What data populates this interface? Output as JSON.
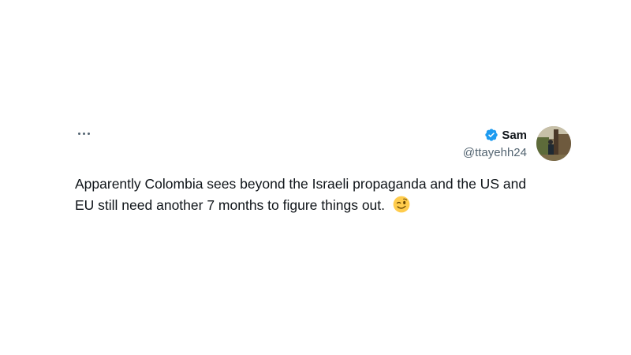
{
  "tweet": {
    "author": {
      "display_name": "Sam",
      "handle": "@ttayehh24",
      "verified": true,
      "verified_icon": "verified-badge-icon",
      "avatar": "profile-photo"
    },
    "more_icon": "more-options-icon",
    "text_line1": "Apparently Colombia sees beyond the Israeli propaganda and the US and",
    "text_line2": "EU still need another 7 months to figure things out.",
    "emoji": "winking-face-emoji"
  },
  "colors": {
    "verified_blue": "#1d9bf0",
    "text_primary": "#0f1419",
    "text_secondary": "#536471"
  }
}
